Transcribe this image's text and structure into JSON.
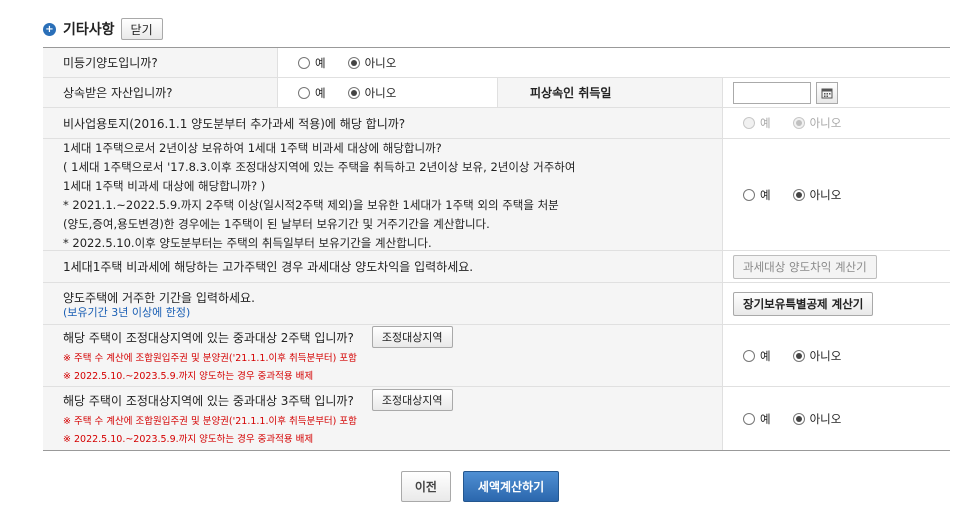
{
  "header": {
    "title": "기타사항",
    "close_label": "닫기",
    "icon": "plus-circle-icon"
  },
  "radio_yes": "예",
  "radio_no": "아니오",
  "rows": {
    "unregistered": {
      "question": "미등기양도입니까?"
    },
    "inherited": {
      "question": "상속받은 자산입니까?",
      "acq_label": "피상속인 취득일",
      "acq_value": ""
    },
    "nonbusiness": {
      "question": "비사업용토지(2016.1.1 양도분부터 추가과세 적용)에 해당 합니까?"
    },
    "oneHouse": {
      "line1": "1세대 1주택으로서 2년이상 보유하여 1세대 1주택 비과세 대상에 해당합니까?",
      "line2": "( 1세대 1주택으로서 '17.8.3.이후 조정대상지역에 있는 주택을 취득하고 2년이상 보유, 2년이상 거주하여",
      "line3": "1세대 1주택 비과세 대상에 해당합니까? )",
      "line4": "* 2021.1.~2022.5.9.까지 2주택 이상(일시적2주택 제외)을 보유한 1세대가 1주택 외의 주택을 처분",
      "line5": "(양도,증여,용도변경)한 경우에는 1주택이 된 날부터 보유기간 및 거주기간을 계산합니다.",
      "line6": "* 2022.5.10.이후 양도분부터는 주택의 취득일부터 보유기간을 계산합니다."
    },
    "luxury": {
      "question": "1세대1주택 비과세에 해당하는 고가주택인 경우 과세대상 양도차익을 입력하세요.",
      "button": "과세대상 양도차익 계산기"
    },
    "residence": {
      "question": "양도주택에 거주한 기간을 입력하세요.",
      "note": "(보유기간 3년 이상에 한정)",
      "button": "장기보유특별공제 계산기"
    },
    "twoHouse": {
      "question": "해당 주택이 조정대상지역에 있는 중과대상 2주택 입니까?",
      "button": "조정대상지역",
      "note1": "※ 주택 수 계산에 조합원입주권 및 분양권('21.1.1.이후 취득분부터) 포함",
      "note2": "※ 2022.5.10.~2023.5.9.까지 양도하는 경우 중과적용 배제"
    },
    "threeHouse": {
      "question": "해당 주택이 조정대상지역에 있는 중과대상 3주택 입니까?",
      "button": "조정대상지역",
      "note1": "※ 주택 수 계산에 조합원입주권 및 분양권('21.1.1.이후 취득분부터) 포함",
      "note2": "※ 2022.5.10.~2023.5.9.까지 양도하는 경우 중과적용 배제"
    }
  },
  "footer": {
    "prev_label": "이전",
    "submit_label": "세액계산하기"
  },
  "colors": {
    "accent": "#2b67ad",
    "note_red": "#d40000",
    "note_blue": "#1a5fb4"
  }
}
